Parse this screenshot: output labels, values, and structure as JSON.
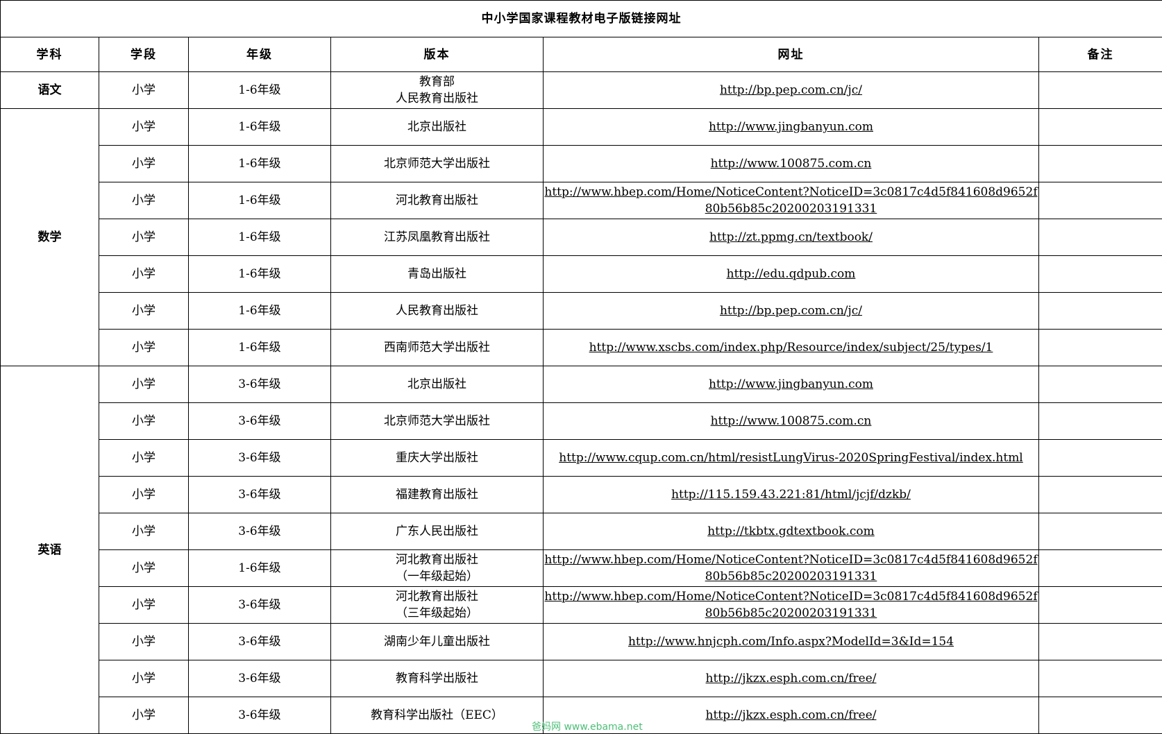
{
  "title": "中小学国家课程教材电子版链接网址",
  "headers": [
    "学科",
    "学段",
    "年级",
    "版本",
    "网址",
    "备注"
  ],
  "groups": [
    {
      "subject": "语文",
      "rows": [
        {
          "stage": "小学",
          "grade": "1-6年级",
          "publisher": [
            "教育部",
            "人民教育出版社"
          ],
          "url": "http://bp.pep.com.cn/jc/",
          "note": ""
        }
      ]
    },
    {
      "subject": "数学",
      "rows": [
        {
          "stage": "小学",
          "grade": "1-6年级",
          "publisher": [
            "北京出版社"
          ],
          "url": "http://www.jingbanyun.com",
          "note": ""
        },
        {
          "stage": "小学",
          "grade": "1-6年级",
          "publisher": [
            "北京师范大学出版社"
          ],
          "url": "http://www.100875.com.cn",
          "note": ""
        },
        {
          "stage": "小学",
          "grade": "1-6年级",
          "publisher": [
            "河北教育出版社"
          ],
          "url": "http://www.hbep.com/Home/NoticeContent?NoticeID=3c0817c4d5f841608d9652f80b56b85c20200203191331",
          "note": ""
        },
        {
          "stage": "小学",
          "grade": "1-6年级",
          "publisher": [
            "江苏凤凰教育出版社"
          ],
          "url": "http://zt.ppmg.cn/textbook/",
          "note": ""
        },
        {
          "stage": "小学",
          "grade": "1-6年级",
          "publisher": [
            "青岛出版社"
          ],
          "url": "http://edu.qdpub.com",
          "note": ""
        },
        {
          "stage": "小学",
          "grade": "1-6年级",
          "publisher": [
            "人民教育出版社"
          ],
          "url": "http://bp.pep.com.cn/jc/",
          "note": ""
        },
        {
          "stage": "小学",
          "grade": "1-6年级",
          "publisher": [
            "西南师范大学出版社"
          ],
          "url": "http://www.xscbs.com/index.php/Resource/index/subject/25/types/1",
          "note": ""
        }
      ]
    },
    {
      "subject": "英语",
      "rows": [
        {
          "stage": "小学",
          "grade": "3-6年级",
          "publisher": [
            "北京出版社"
          ],
          "url": "http://www.jingbanyun.com",
          "note": ""
        },
        {
          "stage": "小学",
          "grade": "3-6年级",
          "publisher": [
            "北京师范大学出版社"
          ],
          "url": "http://www.100875.com.cn",
          "note": ""
        },
        {
          "stage": "小学",
          "grade": "3-6年级",
          "publisher": [
            "重庆大学出版社"
          ],
          "url": "http://www.cqup.com.cn/html/resistLungVirus-2020SpringFestival/index.html",
          "note": ""
        },
        {
          "stage": "小学",
          "grade": "3-6年级",
          "publisher": [
            "福建教育出版社"
          ],
          "url": "http://115.159.43.221:81/html/jcjf/dzkb/",
          "note": ""
        },
        {
          "stage": "小学",
          "grade": "3-6年级",
          "publisher": [
            "广东人民出版社"
          ],
          "url": "http://tkbtx.gdtextbook.com",
          "note": ""
        },
        {
          "stage": "小学",
          "grade": "1-6年级",
          "publisher": [
            "河北教育出版社",
            "（一年级起始）"
          ],
          "url": "http://www.hbep.com/Home/NoticeContent?NoticeID=3c0817c4d5f841608d9652f80b56b85c20200203191331",
          "note": ""
        },
        {
          "stage": "小学",
          "grade": "3-6年级",
          "publisher": [
            "河北教育出版社",
            "（三年级起始）"
          ],
          "url": "http://www.hbep.com/Home/NoticeContent?NoticeID=3c0817c4d5f841608d9652f80b56b85c20200203191331",
          "note": ""
        },
        {
          "stage": "小学",
          "grade": "3-6年级",
          "publisher": [
            "湖南少年儿童出版社"
          ],
          "url": "http://www.hnjcph.com/Info.aspx?ModelId=3&Id=154",
          "note": ""
        },
        {
          "stage": "小学",
          "grade": "3-6年级",
          "publisher": [
            "教育科学出版社"
          ],
          "url": "http://jkzx.esph.com.cn/free/",
          "note": ""
        },
        {
          "stage": "小学",
          "grade": "3-6年级",
          "publisher": [
            "教育科学出版社（EEC）"
          ],
          "url": "http://jkzx.esph.com.cn/free/",
          "note": ""
        }
      ]
    }
  ],
  "watermark": "爸妈网 www.ebama.net"
}
